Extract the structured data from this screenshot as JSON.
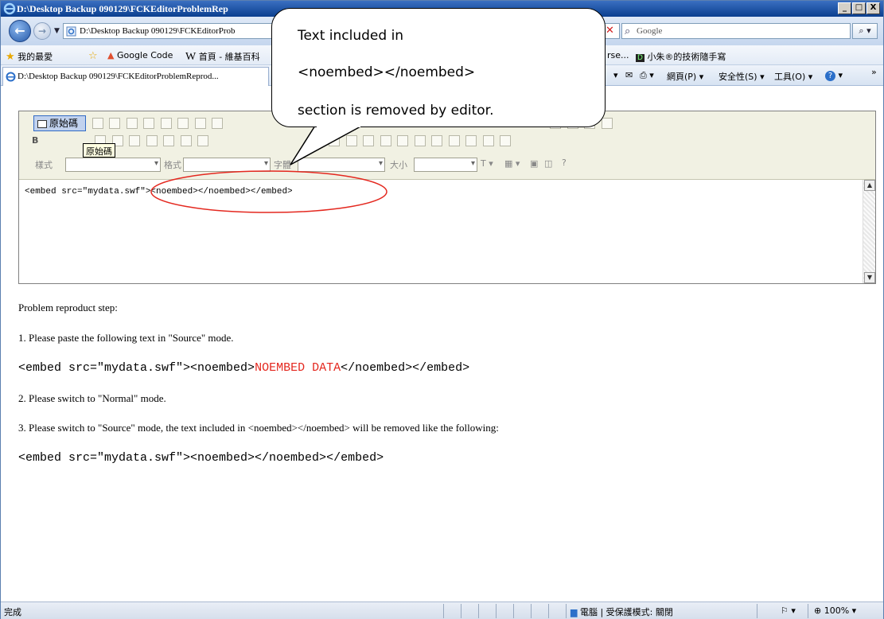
{
  "window": {
    "title": "D:\\Desktop Backup 090129\\FCKEditorProblemRep",
    "controls": [
      "_",
      "□",
      "X"
    ]
  },
  "address_bar": {
    "url": "D:\\Desktop Backup 090129\\FCKEditorProb",
    "search_placeholder": "Google"
  },
  "favorites_bar": {
    "favorites_label": "我的最愛",
    "items": [
      "Google Code",
      "首頁 - 維基百科",
      "rse...",
      "小朱®的技術隨手寫"
    ]
  },
  "command_bar": {
    "tab_title": "D:\\Desktop Backup 090129\\FCKEditorProblemReprod...",
    "page_menu": "網頁(P)",
    "safety_menu": "安全性(S)",
    "tools_menu": "工具(O)"
  },
  "editor": {
    "source_button": "原始碼",
    "tooltip": "原始碼",
    "combo_style": "樣式",
    "combo_format": "格式",
    "combo_font": "字體",
    "combo_size": "大小",
    "bold": "B",
    "source_text": "<embed src=\"mydata.swf\"><noembed></noembed></embed>"
  },
  "content": {
    "heading": "Problem reproduct step:",
    "step1": "1. Please paste the following text in \"Source\" mode.",
    "code1_a": "<embed src=\"mydata.swf\"><noembed>",
    "code1_red": "NOEMBED DATA",
    "code1_b": "</noembed></embed>",
    "step2": "2. Please switch to \"Normal\" mode.",
    "step3": "3. Please switch to \"Source\" mode, the text included in <noembed></noembed> will be removed like the following:",
    "code2": "<embed src=\"mydata.swf\"><noembed></noembed></embed>"
  },
  "callout": {
    "line1": "Text included in",
    "line2": "<noembed></noembed>",
    "line3": "section is removed by editor."
  },
  "status_bar": {
    "status": "完成",
    "zone": "電腦 | 受保護模式: 關閉",
    "zoom": "100%"
  },
  "colors": {
    "annotation": "#e4281f",
    "titlebar": "#0a3f8f"
  }
}
